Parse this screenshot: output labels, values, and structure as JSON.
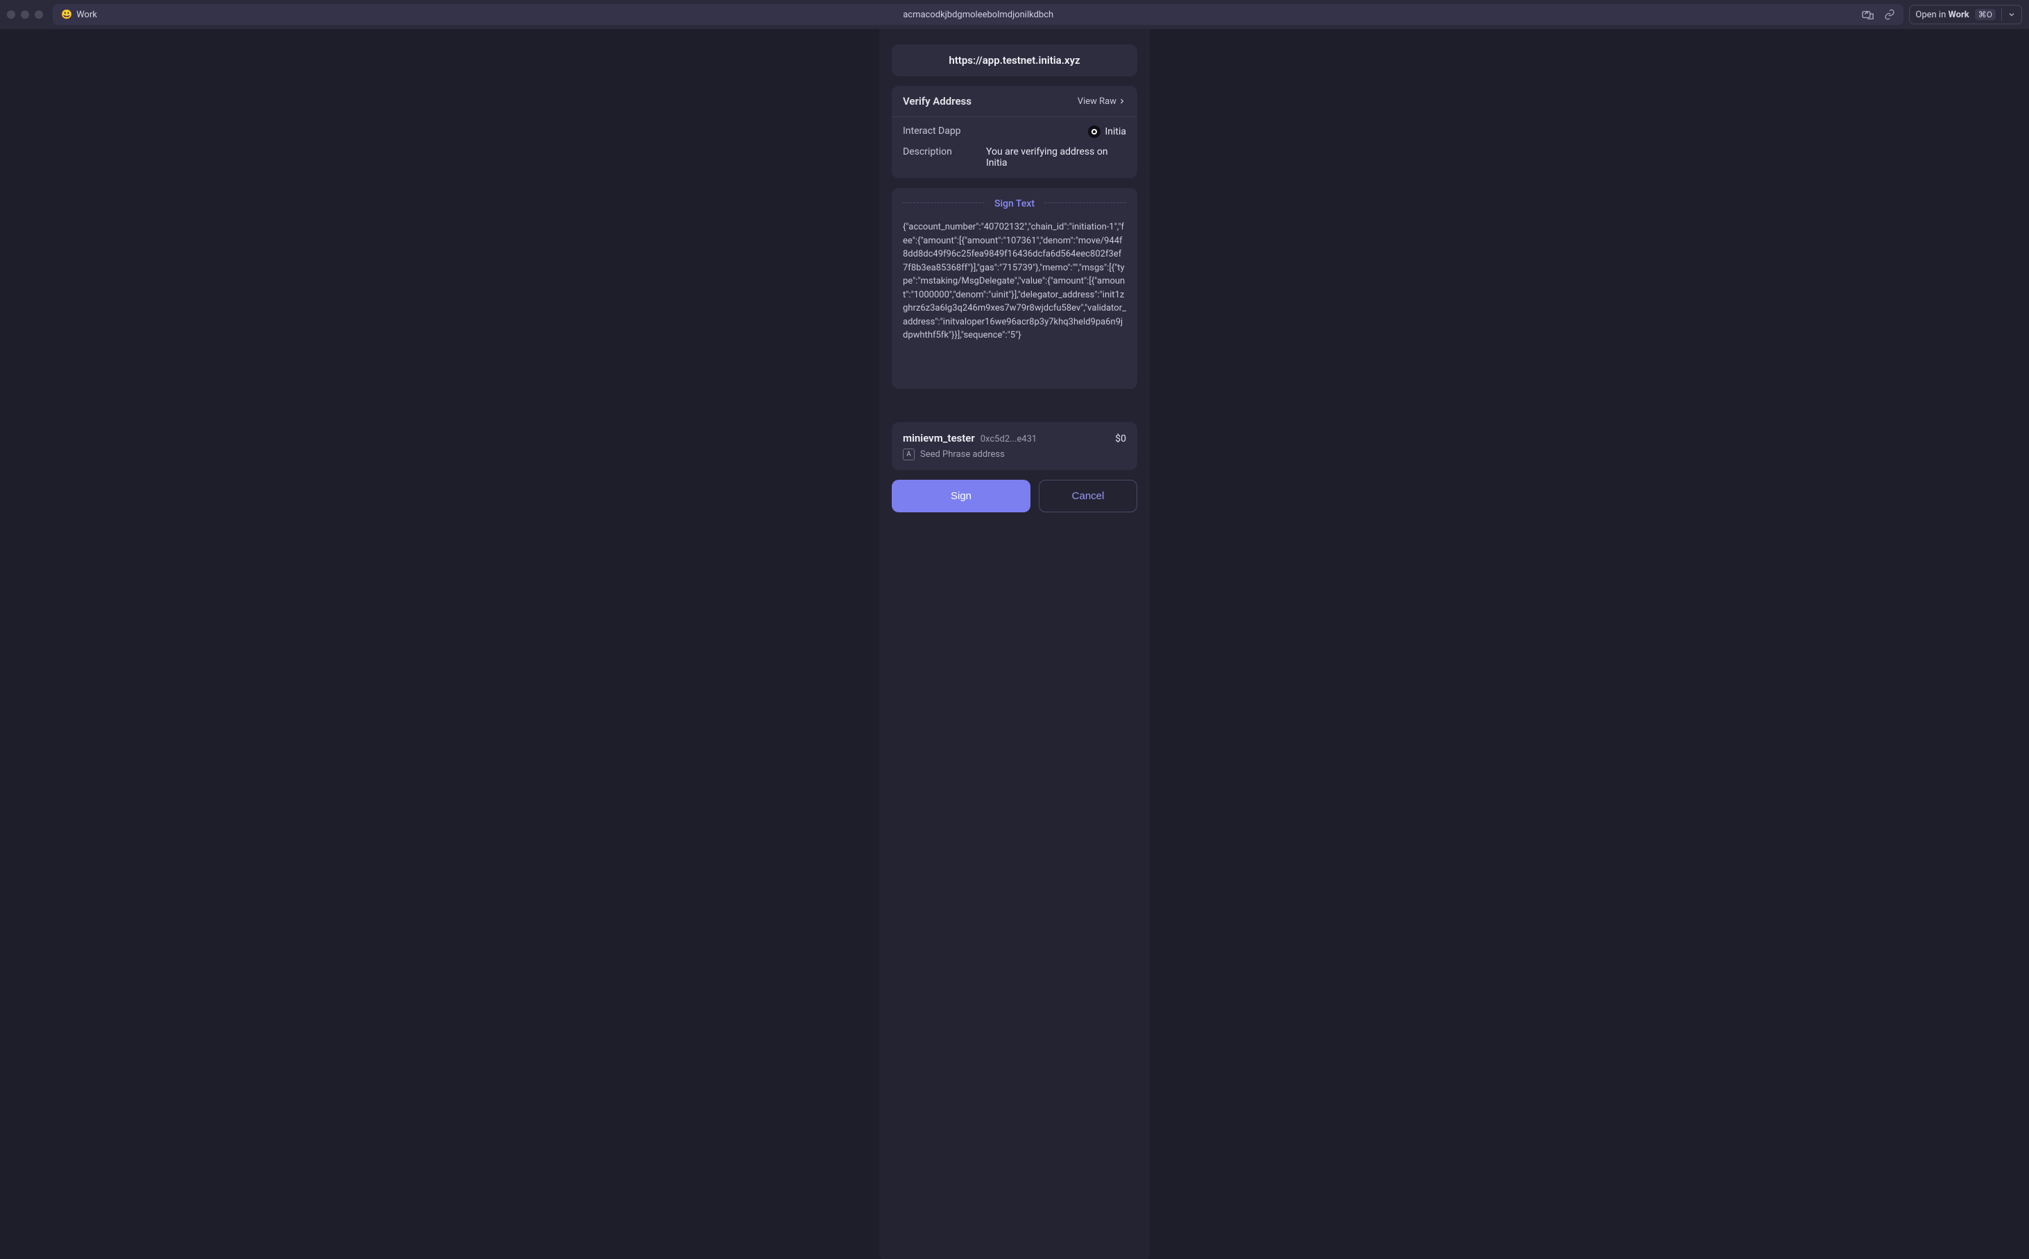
{
  "titlebar": {
    "profile": "Work",
    "location": "acmacodkjbdgmoleebolmdjonilkdbch",
    "open_in_prefix": "Open in ",
    "open_in_profile": "Work",
    "shortcut": "⌘O"
  },
  "popup": {
    "origin": "https://app.testnet.initia.xyz",
    "verify": {
      "title": "Verify Address",
      "view_raw": "View Raw",
      "interact_label": "Interact Dapp",
      "interact_value": "Initia",
      "desc_label": "Description",
      "desc_value": "You are verifying address on Initia"
    },
    "sign": {
      "heading": "Sign Text",
      "text": "{\"account_number\":\"40702132\",\"chain_id\":\"initiation-1\",\"fee\":{\"amount\":[{\"amount\":\"107361\",\"denom\":\"move/944f8dd8dc49f96c25fea9849f16436dcfa6d564eec802f3ef7f8b3ea85368ff\"}],\"gas\":\"715739\"},\"memo\":\"\",\"msgs\":[{\"type\":\"mstaking/MsgDelegate\",\"value\":{\"amount\":[{\"amount\":\"1000000\",\"denom\":\"uinit\"}],\"delegator_address\":\"init1zghrz6z3a6lg3q246m9xes7w79r8wjdcfu58ev\",\"validator_address\":\"initvaloper16we96acr8p3y7khq3held9pa6n9jdpwhthf5fk\"}}],\"sequence\":\"5\"}"
    },
    "account": {
      "name": "minievm_tester",
      "address": "0xc5d2...e431",
      "balance": "$0",
      "type_label": "Seed Phrase address",
      "badge": "A"
    },
    "buttons": {
      "sign": "Sign",
      "cancel": "Cancel"
    }
  }
}
